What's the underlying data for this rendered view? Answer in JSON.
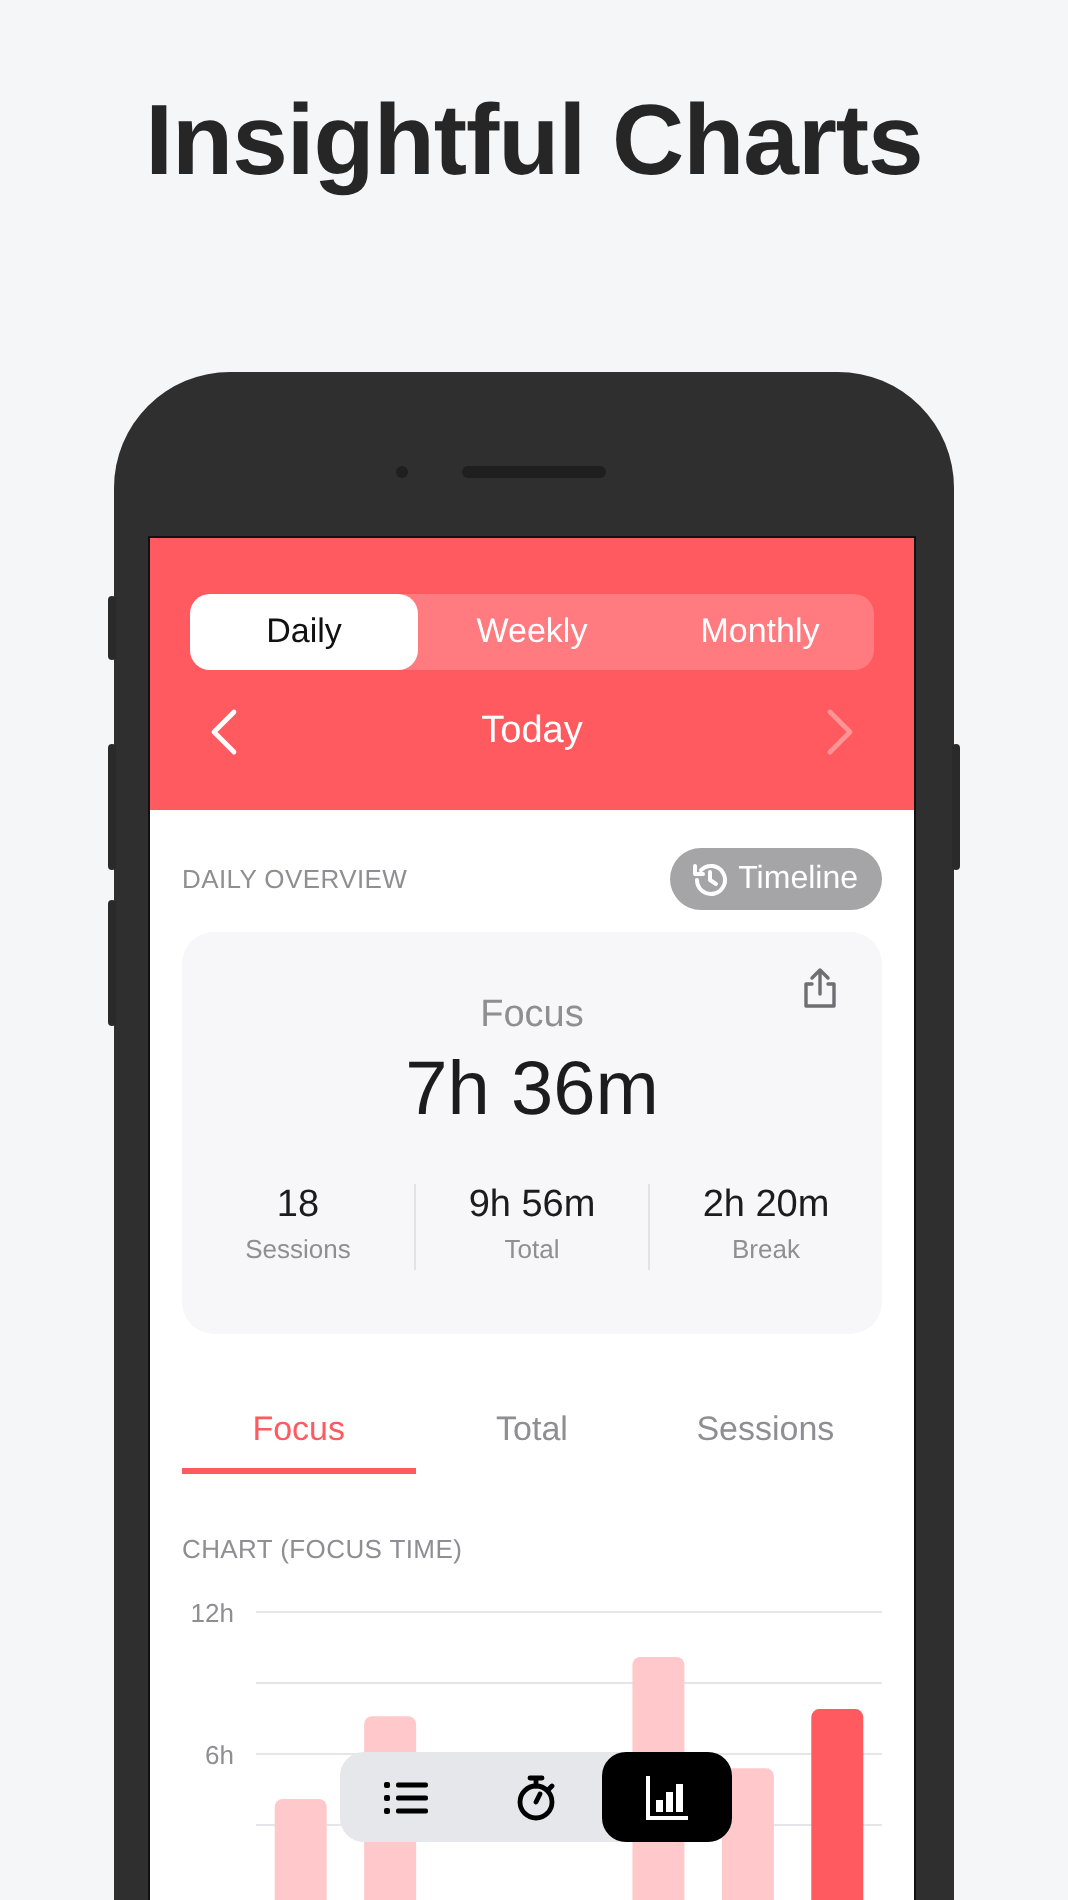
{
  "headline": "Insightful Charts",
  "period_tabs": [
    {
      "label": "Daily",
      "selected": true
    },
    {
      "label": "Weekly",
      "selected": false
    },
    {
      "label": "Monthly",
      "selected": false
    }
  ],
  "date_nav": {
    "title": "Today",
    "prev_disabled": false,
    "next_disabled": true
  },
  "overview": {
    "heading": "DAILY OVERVIEW",
    "timeline_button": "Timeline",
    "focus_label": "Focus",
    "focus_value": "7h 36m",
    "stats": [
      {
        "value": "18",
        "label": "Sessions"
      },
      {
        "value": "9h 56m",
        "label": "Total"
      },
      {
        "value": "2h 20m",
        "label": "Break"
      }
    ]
  },
  "metric_tabs": [
    {
      "label": "Focus",
      "selected": true
    },
    {
      "label": "Total",
      "selected": false
    },
    {
      "label": "Sessions",
      "selected": false
    }
  ],
  "chart": {
    "heading": "CHART (FOCUS TIME)",
    "chart_data": {
      "type": "bar",
      "ylim": [
        0,
        12
      ],
      "yticks": [
        {
          "value": 6,
          "label": "6h"
        },
        {
          "value": 12,
          "label": "12h"
        }
      ],
      "series": [
        {
          "color": "#ffc9cb",
          "values": [
            4.1,
            7.6,
            null,
            null,
            10.1,
            5.4,
            null
          ]
        },
        {
          "color": "#ff5a5f",
          "values": [
            null,
            null,
            null,
            null,
            null,
            null,
            7.9
          ]
        }
      ]
    }
  },
  "dock": [
    {
      "kind": "list",
      "selected": false
    },
    {
      "kind": "timer",
      "selected": false
    },
    {
      "kind": "chart",
      "selected": true
    }
  ]
}
